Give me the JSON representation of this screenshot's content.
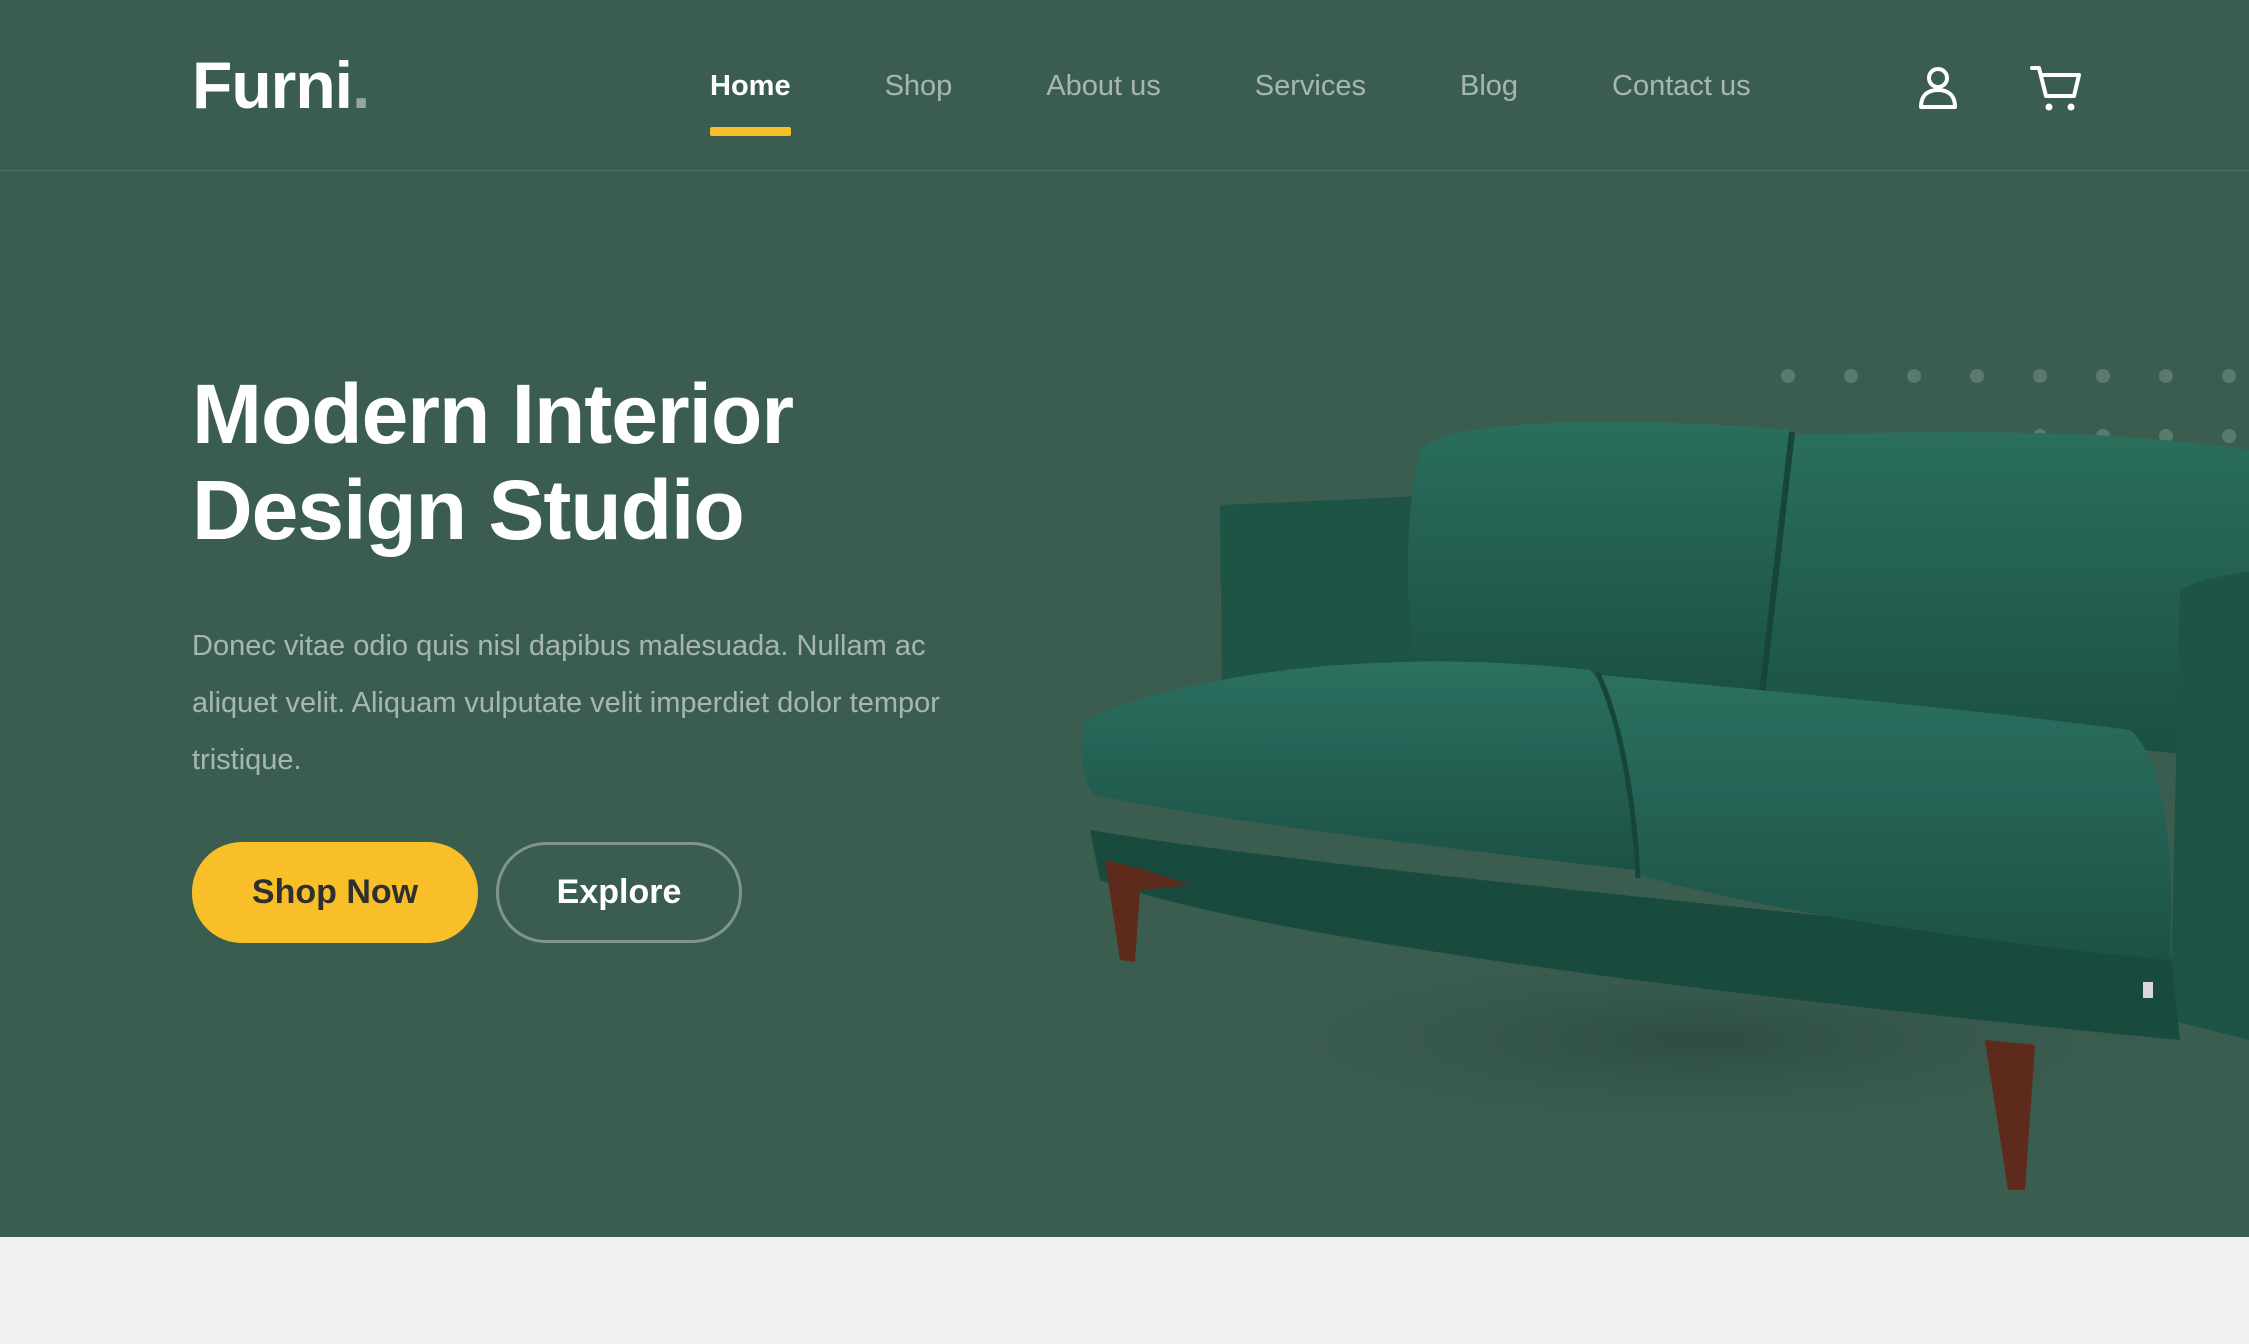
{
  "brand": {
    "name": "Furni",
    "dot": "."
  },
  "nav": {
    "items": [
      {
        "label": "Home",
        "active": true
      },
      {
        "label": "Shop",
        "active": false
      },
      {
        "label": "About us",
        "active": false
      },
      {
        "label": "Services",
        "active": false
      },
      {
        "label": "Blog",
        "active": false
      },
      {
        "label": "Contact us",
        "active": false
      }
    ],
    "icons": [
      "user-icon",
      "cart-icon"
    ]
  },
  "hero": {
    "title_line1": "Modern Interior",
    "title_line2": "Design Studio",
    "description": "Donec vitae odio quis nisl dapibus malesuada. Nullam ac aliquet velit. Aliquam vulputate velit imperdiet dolor tempor tristique.",
    "primary_button": "Shop Now",
    "secondary_button": "Explore"
  },
  "colors": {
    "hero_bg": "#3b5d50",
    "accent": "#f9bf29",
    "page_bg": "#eff2f1",
    "sofa": "#1f5a4b",
    "sofa_legs": "#6b2d1f"
  }
}
